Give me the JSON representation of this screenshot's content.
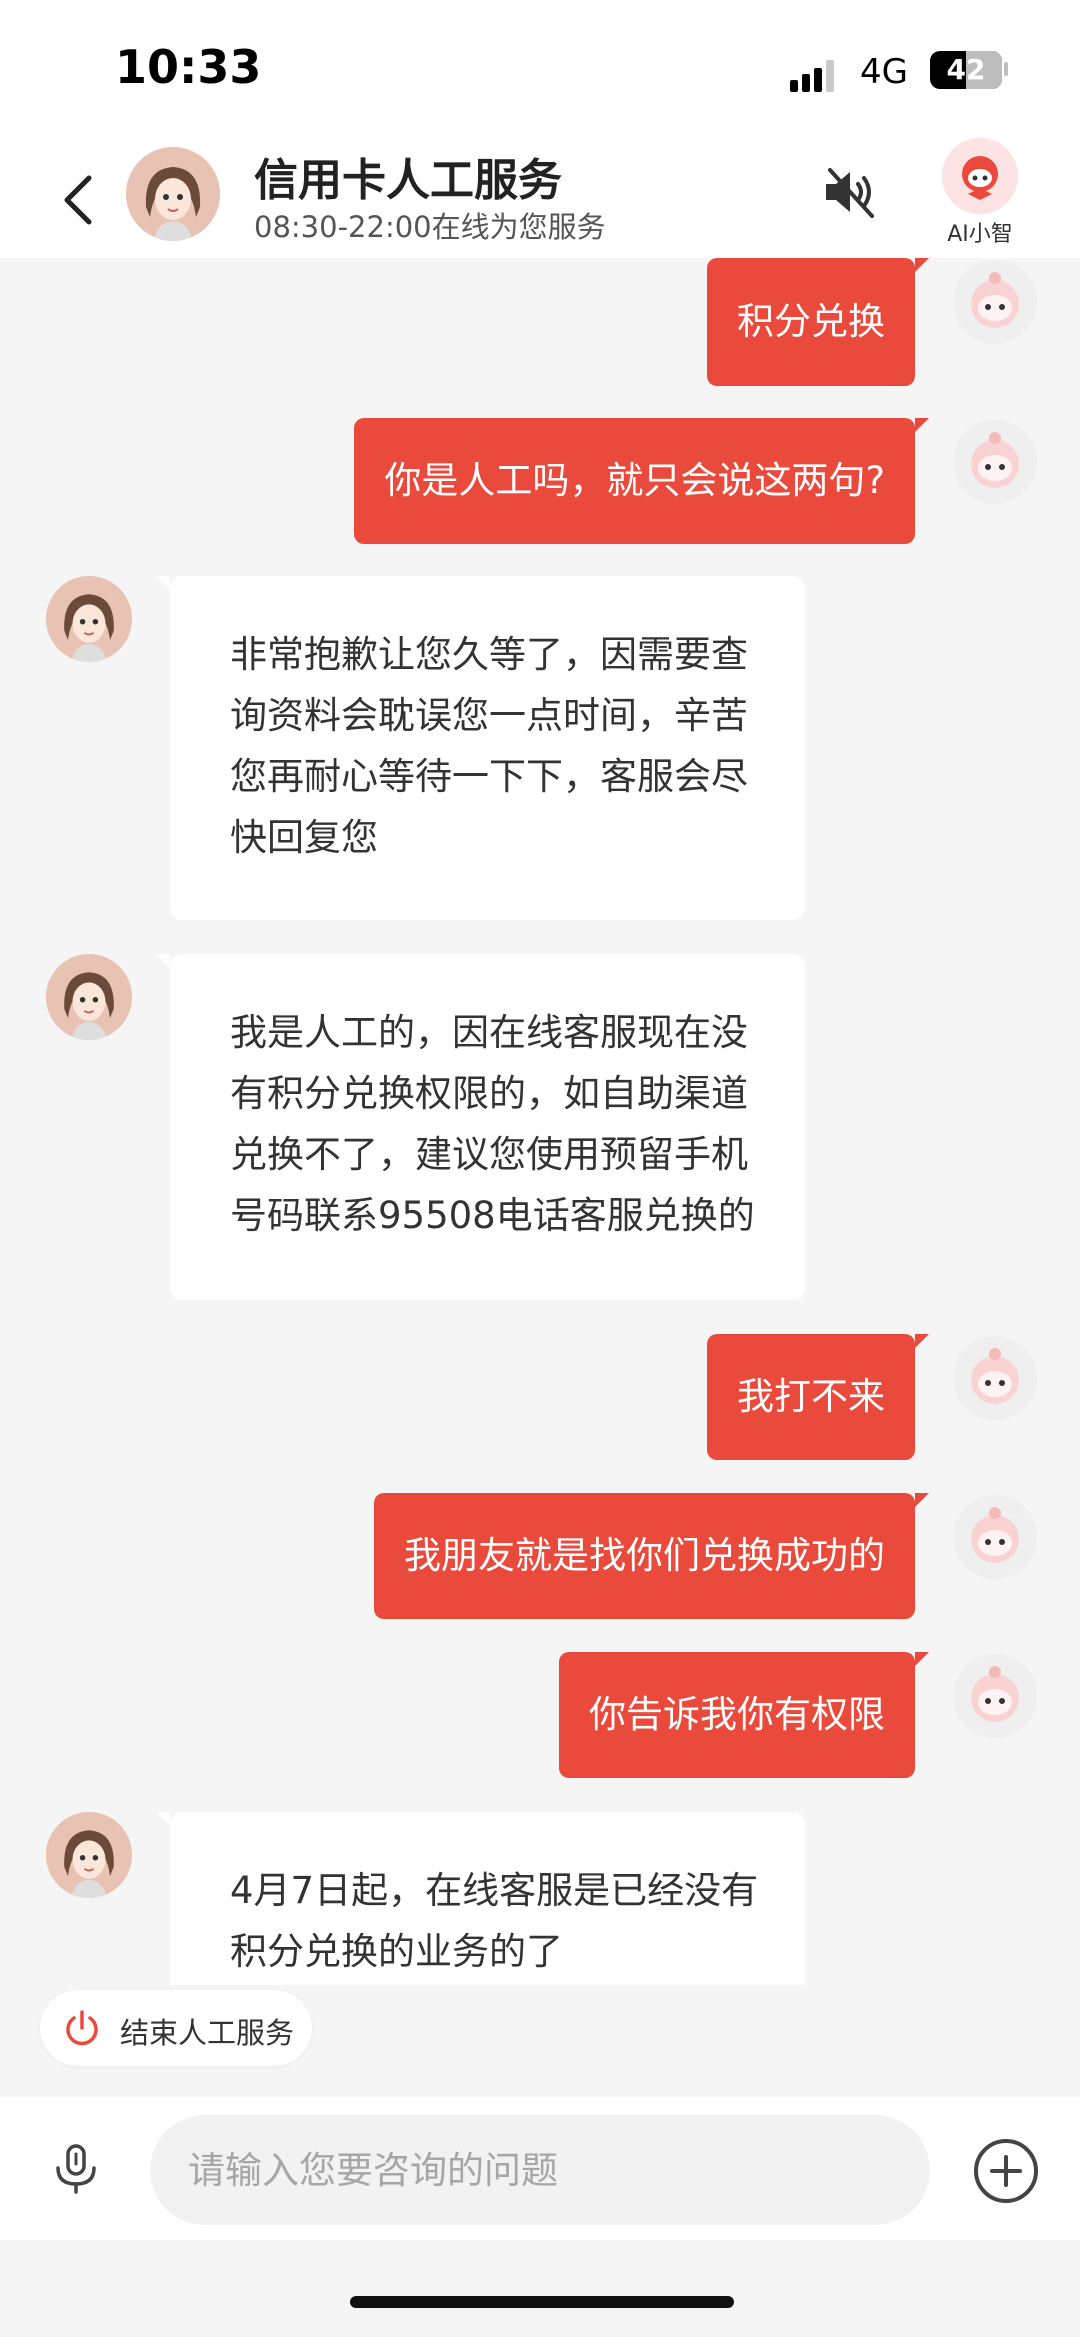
{
  "status_bar": {
    "time": "10:33",
    "network": "4G",
    "battery": "42"
  },
  "header": {
    "title": "信用卡人工服务",
    "subtitle": "08:30-22:00在线为您服务",
    "ai_label": "AI小智"
  },
  "messages": [
    {
      "from": "user",
      "text": "积分兑换"
    },
    {
      "from": "user",
      "text": "你是人工吗，就只会说这两句?"
    },
    {
      "from": "agent",
      "text": "非常抱歉让您久等了，因需要查询资料会耽误您一点时间，辛苦您再耐心等待一下下，客服会尽快回复您"
    },
    {
      "from": "agent",
      "text": "我是人工的，因在线客服现在没有积分兑换权限的，如自助渠道兑换不了，建议您使用预留手机号码联系95508电话客服兑换的"
    },
    {
      "from": "user",
      "text": "我打不来"
    },
    {
      "from": "user",
      "text": "我朋友就是找你们兑换成功的"
    },
    {
      "from": "user",
      "text": "你告诉我你有权限"
    },
    {
      "from": "agent",
      "text": "4月7日起，在线客服是已经没有积分兑换的业务的了"
    }
  ],
  "end_service": {
    "label": "结束人工服务"
  },
  "input": {
    "placeholder": "请输入您要咨询的问题",
    "value": ""
  },
  "icons": {
    "back": "chevron-left-icon",
    "speaker": "speaker-muted-icon",
    "mic": "microphone-icon",
    "plus": "plus-circle-icon",
    "power": "power-icon"
  },
  "colors": {
    "accent": "#e94a3c",
    "background": "#f5f5f5",
    "agent_bubble": "#ffffff"
  }
}
